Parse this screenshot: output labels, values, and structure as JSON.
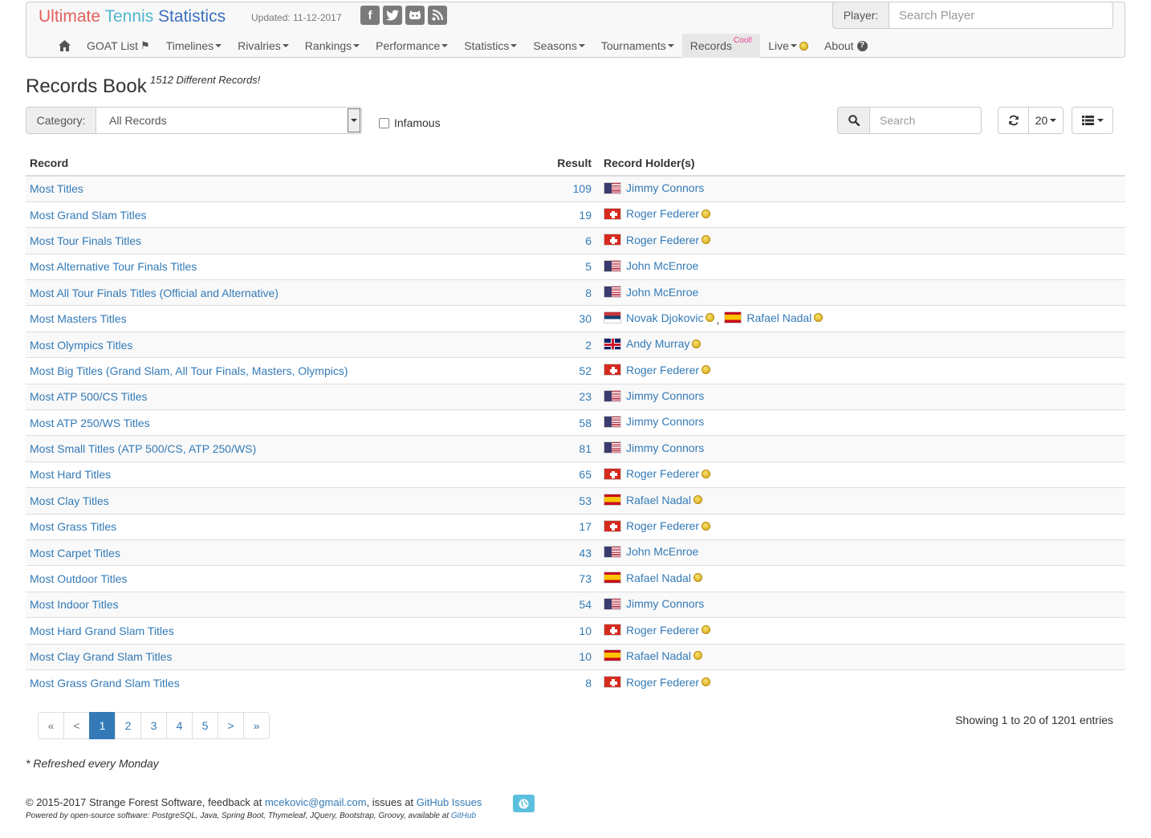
{
  "brand": {
    "part1": "Ultimate",
    "part2": "Tennis",
    "part3": "Statistics"
  },
  "updated": "Updated: 11-12-2017",
  "social_icons": [
    "facebook-icon",
    "twitter-icon",
    "github-icon",
    "rss-icon"
  ],
  "player_search": {
    "label": "Player:",
    "placeholder": "Search Player"
  },
  "menu": {
    "home_icon": "home-icon",
    "goat": "GOAT List",
    "timelines": "Timelines",
    "rivalries": "Rivalries",
    "rankings": "Rankings",
    "performance": "Performance",
    "statistics": "Statistics",
    "seasons": "Seasons",
    "tournaments": "Tournaments",
    "records": "Records",
    "records_badge": "Cool!",
    "live": "Live",
    "about": "About"
  },
  "heading": {
    "title": "Records Book",
    "count": "1512 Different Records!"
  },
  "toolbar": {
    "category_label": "Category:",
    "category_value": "All Records",
    "infamous_label": "Infamous",
    "infamous_checked": false,
    "search_placeholder": "Search",
    "page_size": "20"
  },
  "table": {
    "headers": {
      "record": "Record",
      "result": "Result",
      "holders": "Record Holder(s)"
    },
    "rows": [
      {
        "record": "Most Titles",
        "result": "109",
        "holders": [
          {
            "name": "Jimmy Connors",
            "flag": "us",
            "active": false
          }
        ]
      },
      {
        "record": "Most Grand Slam Titles",
        "result": "19",
        "holders": [
          {
            "name": "Roger Federer",
            "flag": "ch",
            "active": true
          }
        ]
      },
      {
        "record": "Most Tour Finals Titles",
        "result": "6",
        "holders": [
          {
            "name": "Roger Federer",
            "flag": "ch",
            "active": true
          }
        ]
      },
      {
        "record": "Most Alternative Tour Finals Titles",
        "result": "5",
        "holders": [
          {
            "name": "John McEnroe",
            "flag": "us",
            "active": false
          }
        ]
      },
      {
        "record": "Most All Tour Finals Titles (Official and Alternative)",
        "result": "8",
        "holders": [
          {
            "name": "John McEnroe",
            "flag": "us",
            "active": false
          }
        ]
      },
      {
        "record": "Most Masters Titles",
        "result": "30",
        "holders": [
          {
            "name": "Novak Djokovic",
            "flag": "rs",
            "active": true
          },
          {
            "name": "Rafael Nadal",
            "flag": "es",
            "active": true
          }
        ]
      },
      {
        "record": "Most Olympics Titles",
        "result": "2",
        "holders": [
          {
            "name": "Andy Murray",
            "flag": "gb",
            "active": true
          }
        ]
      },
      {
        "record": "Most Big Titles (Grand Slam, All Tour Finals, Masters, Olympics)",
        "result": "52",
        "holders": [
          {
            "name": "Roger Federer",
            "flag": "ch",
            "active": true
          }
        ]
      },
      {
        "record": "Most ATP 500/CS Titles",
        "result": "23",
        "holders": [
          {
            "name": "Jimmy Connors",
            "flag": "us",
            "active": false
          }
        ]
      },
      {
        "record": "Most ATP 250/WS Titles",
        "result": "58",
        "holders": [
          {
            "name": "Jimmy Connors",
            "flag": "us",
            "active": false
          }
        ]
      },
      {
        "record": "Most Small Titles (ATP 500/CS, ATP 250/WS)",
        "result": "81",
        "holders": [
          {
            "name": "Jimmy Connors",
            "flag": "us",
            "active": false
          }
        ]
      },
      {
        "record": "Most Hard Titles",
        "result": "65",
        "holders": [
          {
            "name": "Roger Federer",
            "flag": "ch",
            "active": true
          }
        ]
      },
      {
        "record": "Most Clay Titles",
        "result": "53",
        "holders": [
          {
            "name": "Rafael Nadal",
            "flag": "es",
            "active": true
          }
        ]
      },
      {
        "record": "Most Grass Titles",
        "result": "17",
        "holders": [
          {
            "name": "Roger Federer",
            "flag": "ch",
            "active": true
          }
        ]
      },
      {
        "record": "Most Carpet Titles",
        "result": "43",
        "holders": [
          {
            "name": "John McEnroe",
            "flag": "us",
            "active": false
          }
        ]
      },
      {
        "record": "Most Outdoor Titles",
        "result": "73",
        "holders": [
          {
            "name": "Rafael Nadal",
            "flag": "es",
            "active": true
          }
        ]
      },
      {
        "record": "Most Indoor Titles",
        "result": "54",
        "holders": [
          {
            "name": "Jimmy Connors",
            "flag": "us",
            "active": false
          }
        ]
      },
      {
        "record": "Most Hard Grand Slam Titles",
        "result": "10",
        "holders": [
          {
            "name": "Roger Federer",
            "flag": "ch",
            "active": true
          }
        ]
      },
      {
        "record": "Most Clay Grand Slam Titles",
        "result": "10",
        "holders": [
          {
            "name": "Rafael Nadal",
            "flag": "es",
            "active": true
          }
        ]
      },
      {
        "record": "Most Grass Grand Slam Titles",
        "result": "8",
        "holders": [
          {
            "name": "Roger Federer",
            "flag": "ch",
            "active": true
          }
        ]
      }
    ]
  },
  "pagination": {
    "first": "«",
    "prev": "<",
    "pages": [
      "1",
      "2",
      "3",
      "4",
      "5"
    ],
    "current": "1",
    "next": ">",
    "last": "»",
    "showing": "Showing 1 to 20 of 1201 entries"
  },
  "refreshed": "* Refreshed every Monday",
  "footer": {
    "copyright": "© 2015-2017 Strange Forest Software, feedback at",
    "email": "mcekovic@gmail.com",
    "issues_prefix": ", issues at",
    "issues_link": "GitHub Issues",
    "powered": "Powered by open-source software: PostgreSQL, Java, Spring Boot, Thymeleaf, JQuery, Bootstrap, Groovy, available at",
    "powered_link": "GitHub"
  },
  "colors": {
    "link": "#337ab7",
    "brand_red": "#e4605e",
    "brand_teal": "#4fb7cd",
    "brand_blue": "#3b6fbf",
    "info": "#5bc0de"
  }
}
